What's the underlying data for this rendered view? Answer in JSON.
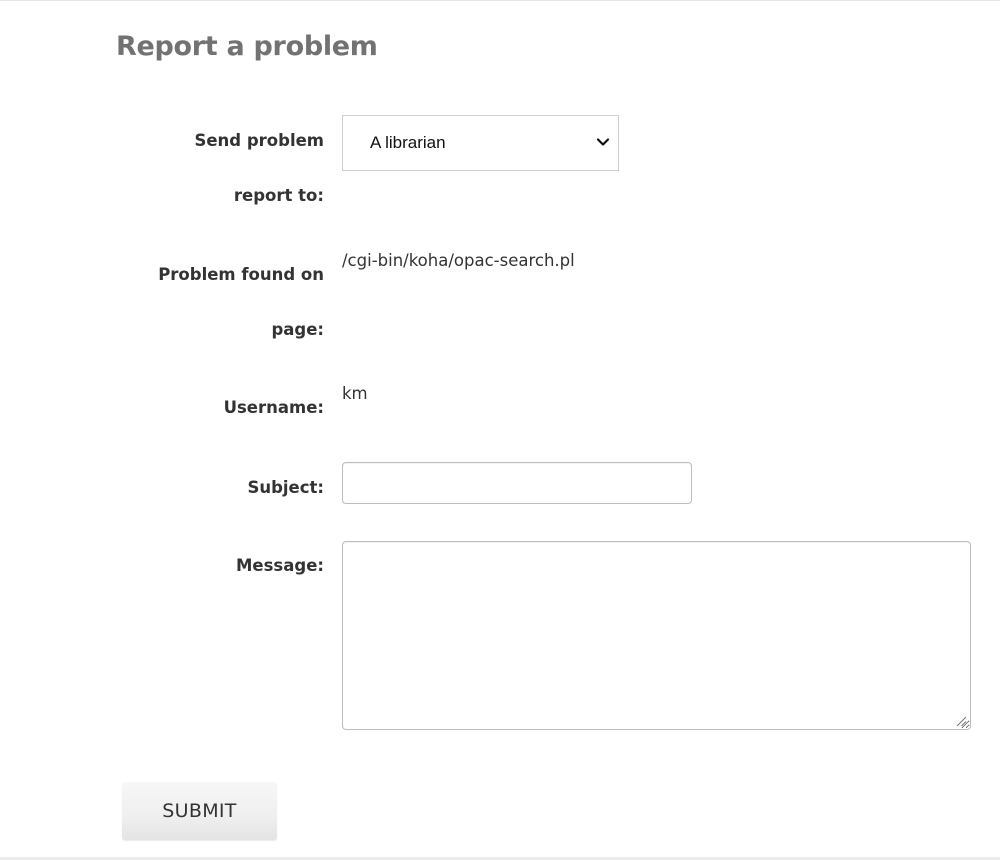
{
  "page": {
    "title": "Report a problem"
  },
  "form": {
    "recipient": {
      "label_line1": "Send problem",
      "label_line2": "report to:",
      "selected": "A librarian"
    },
    "problem_page": {
      "label_line1": "Problem found on",
      "label_line2": "page:",
      "value": "/cgi-bin/koha/opac-search.pl"
    },
    "username": {
      "label": "Username:",
      "value": "km"
    },
    "subject": {
      "label": "Subject:",
      "value": ""
    },
    "message": {
      "label": "Message:",
      "value": ""
    },
    "submit_label": "SUBMIT"
  },
  "icons": {
    "select_arrow": "chevron-down-icon",
    "textarea_resize": "resize-grip-icon"
  },
  "colors": {
    "title": "#727272",
    "text": "#333333",
    "input_border": "#bdbdbd",
    "button_bg": "#efefef"
  }
}
